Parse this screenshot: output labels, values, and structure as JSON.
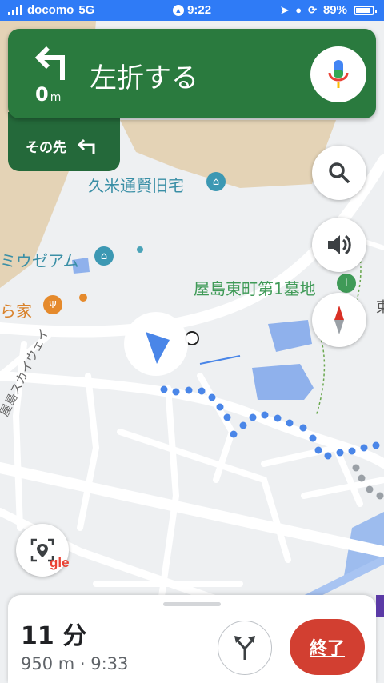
{
  "status_bar": {
    "carrier": "docomo",
    "network": "5G",
    "time": "9:22",
    "battery": "89%"
  },
  "navigation": {
    "instruction": "左折する",
    "distance_value": "0",
    "distance_unit": "m",
    "then_label": "その先"
  },
  "map_labels": {
    "poi_1": "久米通賢旧宅",
    "poi_2": "ミウゼアム",
    "poi_3": "ら家",
    "cemetery": "屋島東町第1墓地",
    "road": "屋島スカイウェイ",
    "edge_char": "東"
  },
  "google_logo": "gle",
  "trip": {
    "duration": "11 分",
    "details": "950 m · 9:33",
    "end_label": "終了"
  },
  "colors": {
    "nav_green": "#2a7a3e",
    "route_blue": "#4a86e8",
    "end_red": "#d23f31",
    "status_blue": "#2f7bf6"
  },
  "icons": [
    "turn-left-icon",
    "mic-icon",
    "search-icon",
    "volume-icon",
    "compass-icon",
    "location-pin-icon",
    "alternate-routes-icon"
  ]
}
